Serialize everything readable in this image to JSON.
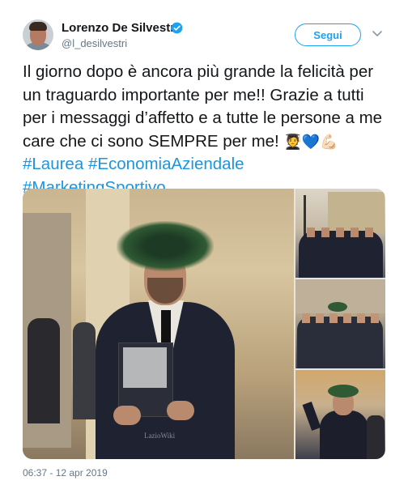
{
  "author": {
    "name": "Lorenzo De Silvestri",
    "handle": "@l_desilvestri",
    "verified": true
  },
  "follow_button": {
    "label": "Segui"
  },
  "menu_icon": "chevron-down-icon",
  "tweet": {
    "text": "Il giorno dopo è ancora più grande la felicità per un traguardo importante per me!! Grazie a tutti per i messaggi d’affetto e a tutte le persone a me care che ci sono SEMPRE per me!",
    "emojis": [
      "🧑‍🎓",
      "💙",
      "💪🏻"
    ],
    "hashtags": [
      "#Laurea",
      "#EconomiaAziendale",
      "#MarketingSportivo"
    ]
  },
  "media": {
    "watermark": "LazioWiki",
    "photos": [
      "graduate-with-laurel-wreath",
      "group-photo-1",
      "group-photo-2",
      "graduate-cheering"
    ]
  },
  "timestamp": "06:37 - 12 apr 2019",
  "colors": {
    "link": "#1b95e0",
    "accent": "#1da1f2",
    "secondary_text": "#657786"
  }
}
